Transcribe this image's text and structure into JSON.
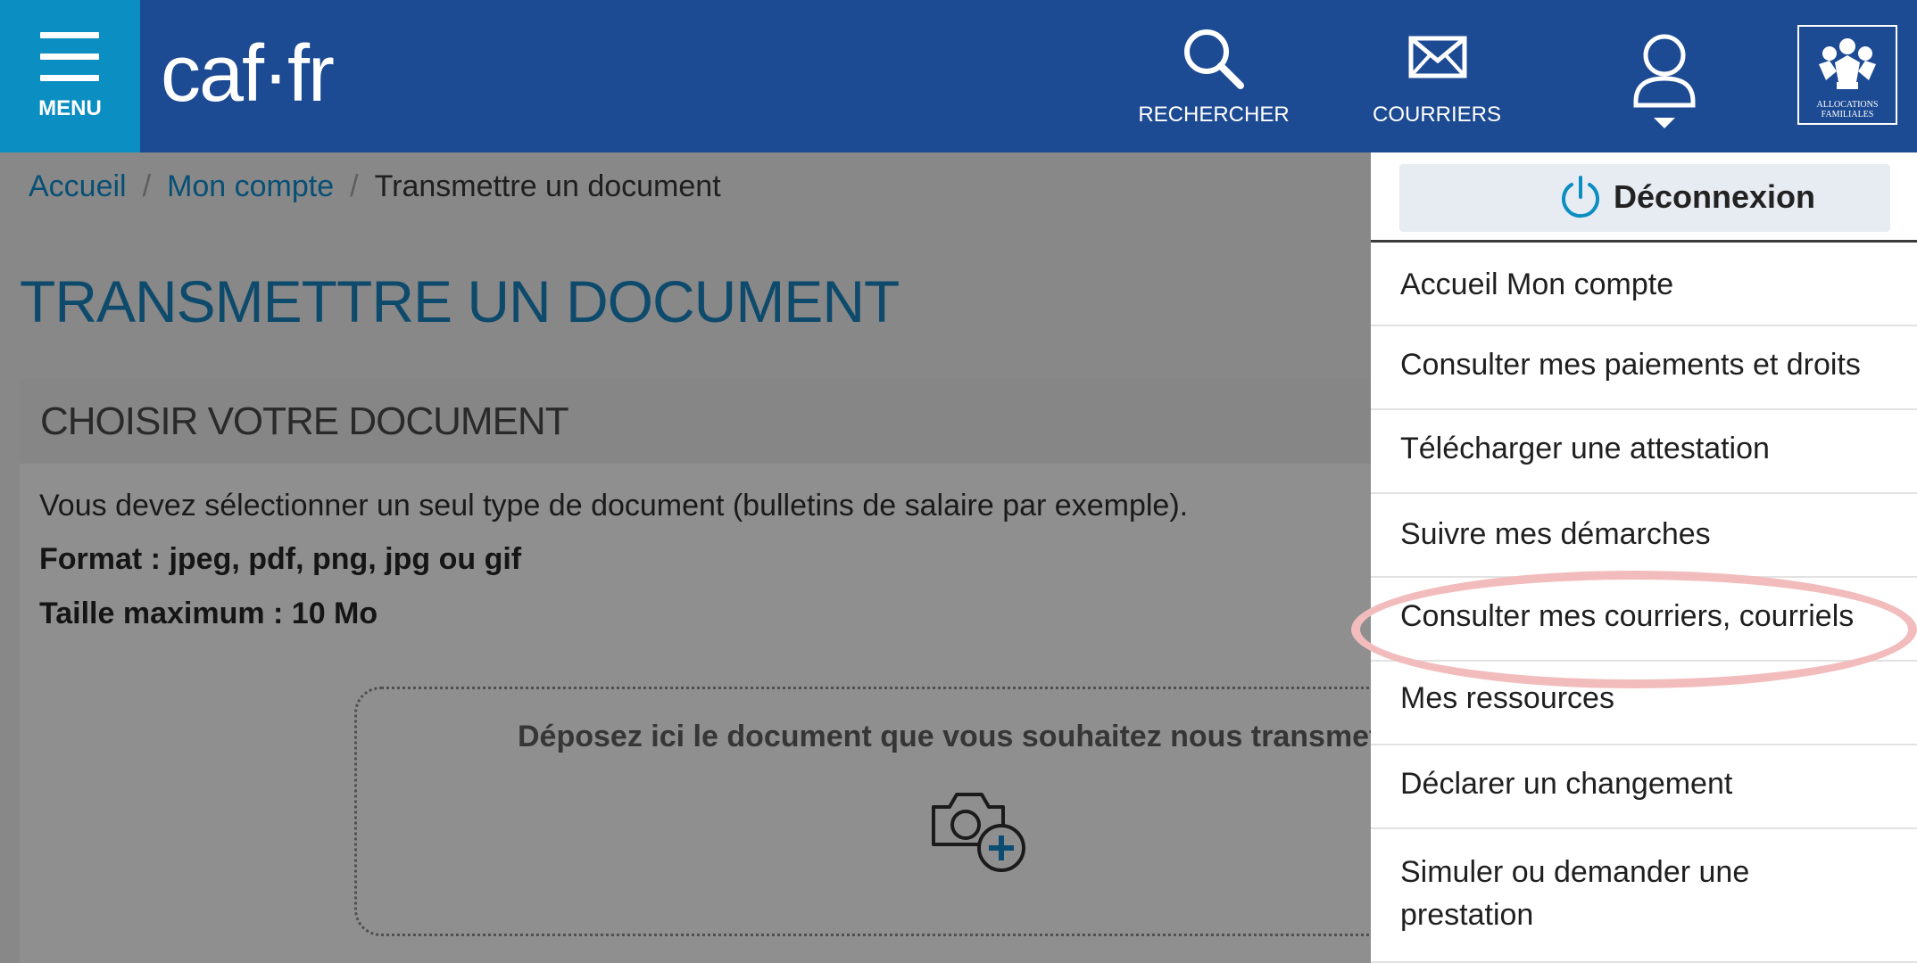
{
  "header": {
    "menu_label": "MENU",
    "logo_text": "caf·fr",
    "search_label": "RECHERCHER",
    "mail_label": "COURRIERS",
    "badge_text": "ALLOCATIONS FAMILIALES",
    "brand_color": "#1c4a93",
    "menu_color": "#0b8ec1"
  },
  "breadcrumb": {
    "items": [
      "Accueil",
      "Mon compte",
      "Transmettre un document"
    ],
    "separator": "/"
  },
  "page_title": "TRANSMETTRE UN DOCUMENT",
  "panel": {
    "title": "CHOISIR VOTRE DOCUMENT",
    "instruction": "Vous devez sélectionner un seul type de document (bulletins de salaire par exemple).",
    "format": "Format : jpeg, pdf, png, jpg ou gif",
    "max_size": "Taille maximum : 10 Mo",
    "dropzone_text": "Déposez ici le document que vous souhaitez nous transmettre"
  },
  "user_menu": {
    "logout_label": "Déconnexion",
    "items": [
      "Accueil Mon compte",
      "Consulter mes paiements et droits",
      "Télécharger une attestation",
      "Suivre mes démarches",
      "Consulter mes courriers, courriels",
      "Mes ressources",
      "Déclarer un changement",
      "Simuler ou demander une prestation"
    ],
    "highlighted_item": "Consulter mes courriers, courriels"
  }
}
